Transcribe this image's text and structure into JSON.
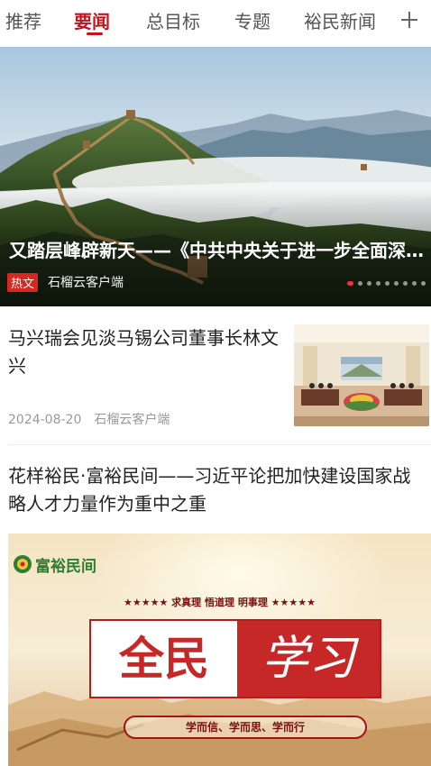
{
  "tabs": [
    {
      "label": "推荐"
    },
    {
      "label": "要闻"
    },
    {
      "label": "总目标"
    },
    {
      "label": "专题"
    },
    {
      "label": "裕民新闻"
    }
  ],
  "active_tab": "要闻",
  "hero": {
    "title": "又踏层峰辟新天——《中共中央关于进一步全面深化改革",
    "badge": "热文",
    "source": "石榴云客户端",
    "slide_count": 9,
    "active_slide": 1
  },
  "articles": [
    {
      "title": "马兴瑞会见淡马锡公司董事长林文兴",
      "date": "2024-08-20",
      "source": "石榴云客户端"
    },
    {
      "title": "花样裕民·富裕民间——习近平论把加快建设国家战略人才力量作为重中之重",
      "banner": {
        "brand": "富裕民间",
        "slogan": "★★★★★ 求真理 悟道理 明事理 ★★★★★",
        "headline_left": "全民",
        "headline_right": "学习",
        "motto": "学而信、学而思、学而行"
      }
    }
  ],
  "colors": {
    "accent": "#c0151b",
    "badge": "#d6281f",
    "meta_text": "#999999"
  }
}
